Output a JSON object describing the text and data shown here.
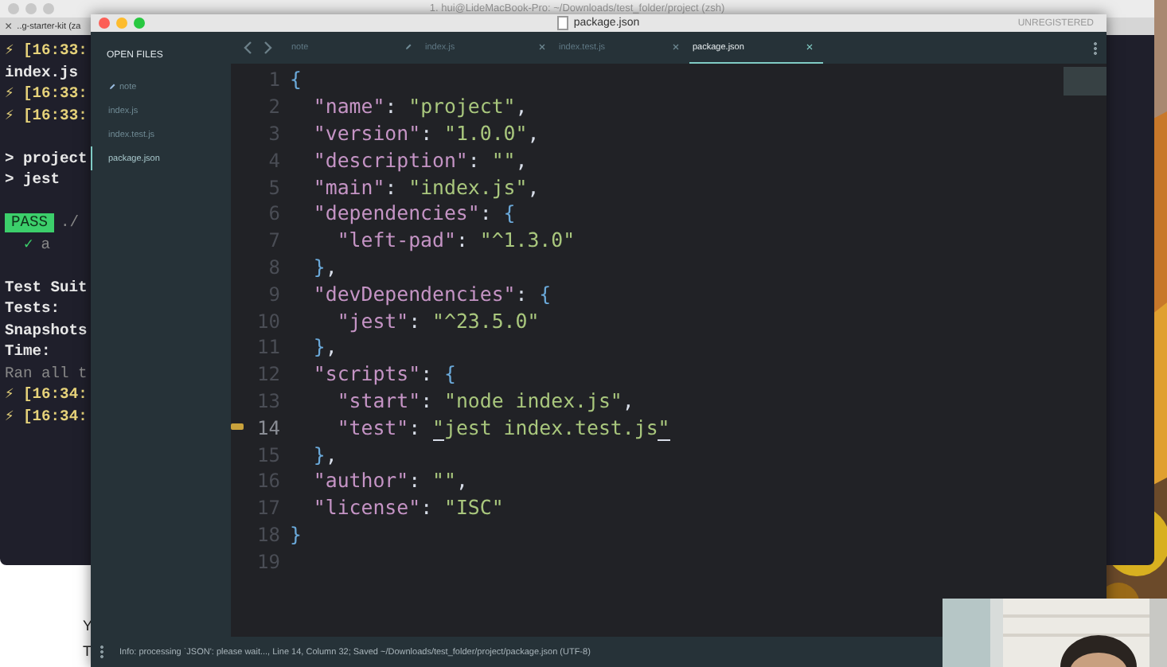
{
  "terminal": {
    "title": "1. hui@LideMacBook-Pro: ~/Downloads/test_folder/project (zsh)",
    "tab": {
      "label": "..g-starter-kit (za",
      "close": "×"
    },
    "lines": [
      {
        "kind": "time",
        "text": "⚡ [16:33:"
      },
      {
        "kind": "plain",
        "text": "index.js"
      },
      {
        "kind": "time",
        "text": "⚡ [16:33:"
      },
      {
        "kind": "time",
        "text": "⚡ [16:33:"
      },
      {
        "kind": "gap"
      },
      {
        "kind": "plain",
        "text": "> project"
      },
      {
        "kind": "plain",
        "text": "> jest"
      },
      {
        "kind": "gap"
      },
      {
        "kind": "pass",
        "badge": "PASS",
        "text": "./"
      },
      {
        "kind": "check",
        "mark": "✓",
        "text": "a"
      },
      {
        "kind": "gap"
      },
      {
        "kind": "plain",
        "text": "Test Suit"
      },
      {
        "kind": "plain",
        "text": "Tests:"
      },
      {
        "kind": "plain",
        "text": "Snapshots"
      },
      {
        "kind": "plain",
        "text": "Time:"
      },
      {
        "kind": "dim",
        "text": "Ran all t"
      },
      {
        "kind": "time",
        "text": "⚡ [16:34:"
      },
      {
        "kind": "time",
        "text": "⚡ [16:34:"
      }
    ]
  },
  "back_window": {
    "lines": [
      "Y",
      "T"
    ]
  },
  "editor": {
    "title": "package.json",
    "license_label": "UNREGISTERED",
    "sidebar": {
      "heading": "OPEN FILES",
      "items": [
        {
          "label": "note",
          "selected": false,
          "modified": true
        },
        {
          "label": "index.js",
          "selected": false,
          "modified": false
        },
        {
          "label": "index.test.js",
          "selected": false,
          "modified": false
        },
        {
          "label": "package.json",
          "selected": true,
          "modified": false
        }
      ]
    },
    "tabs": [
      {
        "label": "note",
        "selected": false,
        "modified": true
      },
      {
        "label": "index.js",
        "selected": false,
        "modified": false
      },
      {
        "label": "index.test.js",
        "selected": false,
        "modified": false
      },
      {
        "label": "package.json",
        "selected": true,
        "modified": false
      }
    ],
    "code": [
      {
        "number": "1",
        "current": false,
        "tokens": [
          {
            "kind": "brace",
            "text": "{"
          }
        ]
      },
      {
        "number": "2",
        "current": false,
        "tokens": [
          {
            "kind": "key",
            "text": "  \"name\""
          },
          {
            "kind": "punct",
            "text": ": "
          },
          {
            "kind": "string",
            "text": "\"project\""
          },
          {
            "kind": "punct",
            "text": ","
          }
        ]
      },
      {
        "number": "3",
        "current": false,
        "tokens": [
          {
            "kind": "key",
            "text": "  \"version\""
          },
          {
            "kind": "punct",
            "text": ": "
          },
          {
            "kind": "string",
            "text": "\"1.0.0\""
          },
          {
            "kind": "punct",
            "text": ","
          }
        ]
      },
      {
        "number": "4",
        "current": false,
        "tokens": [
          {
            "kind": "key",
            "text": "  \"description\""
          },
          {
            "kind": "punct",
            "text": ": "
          },
          {
            "kind": "string",
            "text": "\"\""
          },
          {
            "kind": "punct",
            "text": ","
          }
        ]
      },
      {
        "number": "5",
        "current": false,
        "tokens": [
          {
            "kind": "key",
            "text": "  \"main\""
          },
          {
            "kind": "punct",
            "text": ": "
          },
          {
            "kind": "string",
            "text": "\"index.js\""
          },
          {
            "kind": "punct",
            "text": ","
          }
        ]
      },
      {
        "number": "6",
        "current": false,
        "tokens": [
          {
            "kind": "key",
            "text": "  \"dependencies\""
          },
          {
            "kind": "punct",
            "text": ": "
          },
          {
            "kind": "brace",
            "text": "{"
          }
        ]
      },
      {
        "number": "7",
        "current": false,
        "tokens": [
          {
            "kind": "key",
            "text": "    \"left-pad\""
          },
          {
            "kind": "punct",
            "text": ": "
          },
          {
            "kind": "string",
            "text": "\"^1.3.0\""
          }
        ]
      },
      {
        "number": "8",
        "current": false,
        "tokens": [
          {
            "kind": "brace",
            "text": "  }"
          },
          {
            "kind": "punct",
            "text": ","
          }
        ]
      },
      {
        "number": "9",
        "current": false,
        "tokens": [
          {
            "kind": "key",
            "text": "  \"devDependencies\""
          },
          {
            "kind": "punct",
            "text": ": "
          },
          {
            "kind": "brace",
            "text": "{"
          }
        ]
      },
      {
        "number": "10",
        "current": false,
        "tokens": [
          {
            "kind": "key",
            "text": "    \"jest\""
          },
          {
            "kind": "punct",
            "text": ": "
          },
          {
            "kind": "string",
            "text": "\"^23.5.0\""
          }
        ]
      },
      {
        "number": "11",
        "current": false,
        "tokens": [
          {
            "kind": "brace",
            "text": "  }"
          },
          {
            "kind": "punct",
            "text": ","
          }
        ]
      },
      {
        "number": "12",
        "current": false,
        "tokens": [
          {
            "kind": "key",
            "text": "  \"scripts\""
          },
          {
            "kind": "punct",
            "text": ": "
          },
          {
            "kind": "brace",
            "text": "{"
          }
        ]
      },
      {
        "number": "13",
        "current": false,
        "tokens": [
          {
            "kind": "key",
            "text": "    \"start\""
          },
          {
            "kind": "punct",
            "text": ": "
          },
          {
            "kind": "string",
            "text": "\"node index.js\""
          },
          {
            "kind": "punct",
            "text": ","
          }
        ]
      },
      {
        "number": "14",
        "current": true,
        "tokens": [
          {
            "kind": "key",
            "text": "    \"test\""
          },
          {
            "kind": "punct",
            "text": ": "
          },
          {
            "kind": "marked",
            "text": "\""
          },
          {
            "kind": "string",
            "text": "jest index.test.js"
          },
          {
            "kind": "marked",
            "text": "\""
          }
        ]
      },
      {
        "number": "15",
        "current": false,
        "tokens": [
          {
            "kind": "brace",
            "text": "  }"
          },
          {
            "kind": "punct",
            "text": ","
          }
        ]
      },
      {
        "number": "16",
        "current": false,
        "tokens": [
          {
            "kind": "key",
            "text": "  \"author\""
          },
          {
            "kind": "punct",
            "text": ": "
          },
          {
            "kind": "string",
            "text": "\"\""
          },
          {
            "kind": "punct",
            "text": ","
          }
        ]
      },
      {
        "number": "17",
        "current": false,
        "tokens": [
          {
            "kind": "key",
            "text": "  \"license\""
          },
          {
            "kind": "punct",
            "text": ": "
          },
          {
            "kind": "string",
            "text": "\"ISC\""
          }
        ]
      },
      {
        "number": "18",
        "current": false,
        "tokens": [
          {
            "kind": "brace",
            "text": "}"
          }
        ]
      },
      {
        "number": "19",
        "current": false
      }
    ],
    "status_bar": "Info: processing `JSON': please wait..., Line 14, Column 32; Saved ~/Downloads/test_folder/project/package.json (UTF-8)"
  }
}
